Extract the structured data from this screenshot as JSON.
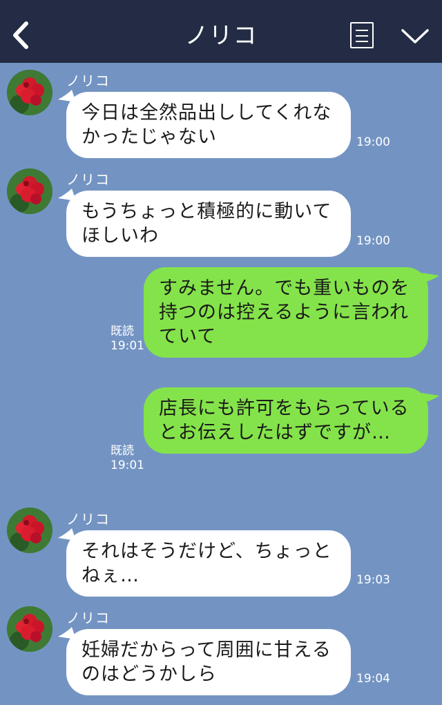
{
  "header": {
    "title": "ノリコ",
    "back_icon": "chevron-left-icon",
    "menu_icon": "menu-lines-icon",
    "expand_icon": "chevron-down-icon",
    "background": "#232c44"
  },
  "chat": {
    "background": "#7394c3",
    "incoming_bubble_color": "#ffffff",
    "outgoing_bubble_color": "#84e34a",
    "messages": [
      {
        "sender": "ノリコ",
        "text": "今日は全然品出ししてくれなかったじゃない",
        "time": "19:00"
      },
      {
        "sender": "ノリコ",
        "text": "もうちょっと積極的に動いてほしいわ",
        "time": "19:00"
      },
      {
        "text": "すみません。でも重いものを持つのは控えるように言われていて",
        "read": "既読",
        "time": "19:01"
      },
      {
        "text": "店長にも許可をもらっているとお伝えしたはずですが…",
        "read": "既読",
        "time": "19:01"
      },
      {
        "sender": "ノリコ",
        "text": "それはそうだけど、ちょっとねぇ…",
        "time": "19:03"
      },
      {
        "sender": "ノリコ",
        "text": "妊婦だからって周囲に甘えるのはどうかしら",
        "time": "19:04"
      }
    ]
  }
}
